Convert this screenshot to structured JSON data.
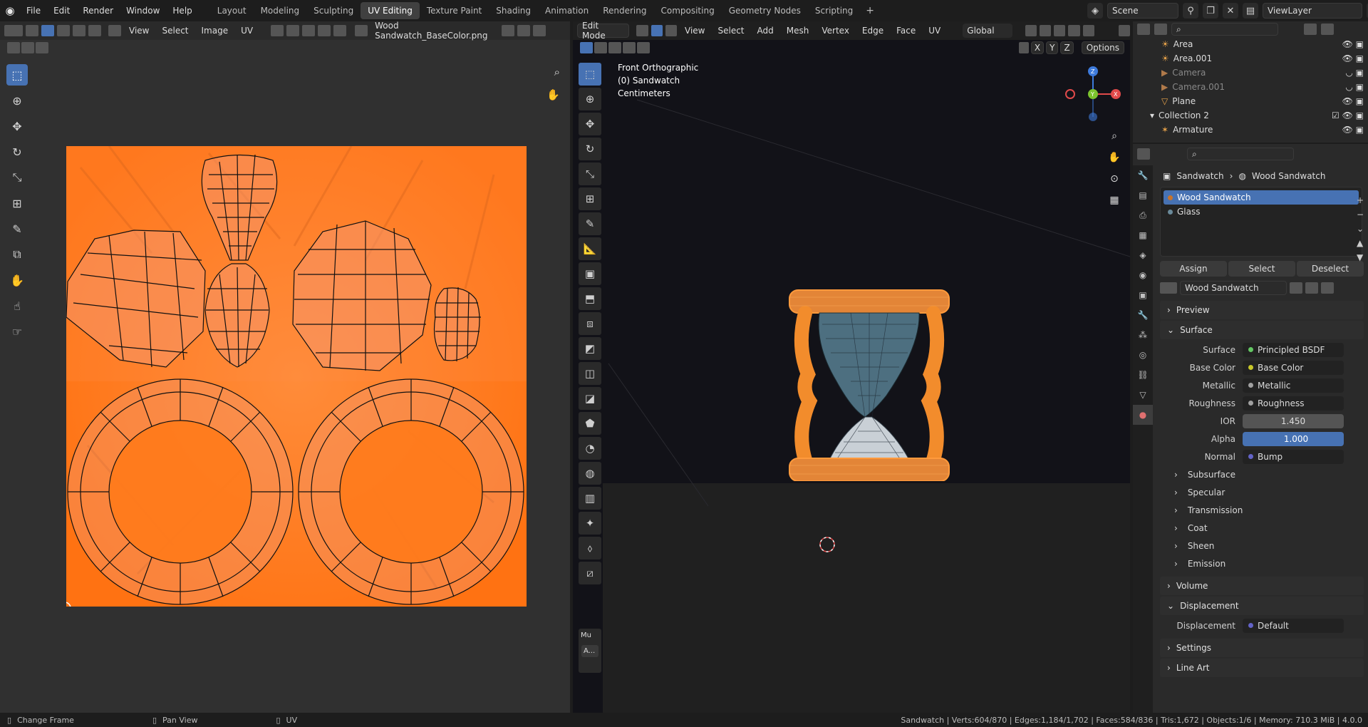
{
  "topbar": {
    "menus": [
      "File",
      "Edit",
      "Render",
      "Window",
      "Help"
    ],
    "workspaces": [
      "Layout",
      "Modeling",
      "Sculpting",
      "UV Editing",
      "Texture Paint",
      "Shading",
      "Animation",
      "Rendering",
      "Compositing",
      "Geometry Nodes",
      "Scripting"
    ],
    "active_workspace": "UV Editing",
    "scene": "Scene",
    "view_layer": "ViewLayer"
  },
  "uv_editor": {
    "menus": [
      "View",
      "Select",
      "Image",
      "UV"
    ],
    "image_name": "Wood Sandwatch_BaseColor.png"
  },
  "viewport": {
    "mode": "Edit Mode",
    "menus": [
      "View",
      "Select",
      "Add",
      "Mesh",
      "Vertex",
      "Edge",
      "Face",
      "UV"
    ],
    "transform_orientation": "Global",
    "options_label": "Options",
    "overlay_lines": [
      "Front Orthographic",
      "(0) Sandwatch",
      "Centimeters"
    ],
    "axes": [
      "X",
      "Y",
      "Z"
    ],
    "last_op_label": "Mu",
    "last_op_sub": "A..."
  },
  "outliner": {
    "rows": [
      {
        "name": "Area",
        "dim": false,
        "indent": 2
      },
      {
        "name": "Area.001",
        "dim": false,
        "indent": 2
      },
      {
        "name": "Camera",
        "dim": true,
        "indent": 2
      },
      {
        "name": "Camera.001",
        "dim": true,
        "indent": 2
      },
      {
        "name": "Plane",
        "dim": false,
        "indent": 2
      },
      {
        "name": "Collection 2",
        "dim": false,
        "indent": 1
      },
      {
        "name": "Armature",
        "dim": false,
        "indent": 2
      }
    ]
  },
  "properties": {
    "object": "Sandwatch",
    "material": "Wood Sandwatch",
    "slots": [
      "Wood Sandwatch",
      "Glass"
    ],
    "buttons": [
      "Assign",
      "Select",
      "Deselect"
    ],
    "sections": {
      "preview": "Preview",
      "surface": "Surface",
      "volume": "Volume",
      "displacement": "Displacement",
      "settings": "Settings",
      "line_art": "Line Art"
    },
    "surface_rows": [
      {
        "label": "Surface",
        "value": "Principled BSDF",
        "type": "link",
        "color": "#63c763"
      },
      {
        "label": "Base Color",
        "value": "Base Color",
        "type": "link",
        "color": "#c7c729"
      },
      {
        "label": "Metallic",
        "value": "Metallic",
        "type": "link",
        "color": "#a1a1a1"
      },
      {
        "label": "Roughness",
        "value": "Roughness",
        "type": "link",
        "color": "#a1a1a1"
      },
      {
        "label": "IOR",
        "value": "1.450",
        "type": "num",
        "color": "#a1a1a1"
      },
      {
        "label": "Alpha",
        "value": "1.000",
        "type": "blue",
        "color": "#a1a1a1"
      },
      {
        "label": "Normal",
        "value": "Bump",
        "type": "link",
        "color": "#6363c7"
      }
    ],
    "subsections": [
      "Subsurface",
      "Specular",
      "Transmission",
      "Coat",
      "Sheen",
      "Emission"
    ],
    "displacement_row": {
      "label": "Displacement",
      "value": "Default",
      "color": "#6363c7"
    }
  },
  "statusbar": {
    "left": [
      "Change Frame",
      "Pan View",
      "UV"
    ],
    "right": "Sandwatch | Verts:604/870 | Edges:1,184/1,702 | Faces:584/836 | Tris:1,672 | Objects:1/6 | Memory: 710.3 MiB | 4.0.0"
  },
  "colors": {
    "accent": "#4772b3",
    "uv_orange": "#ff7a1a",
    "selection": "#f08a2c"
  }
}
